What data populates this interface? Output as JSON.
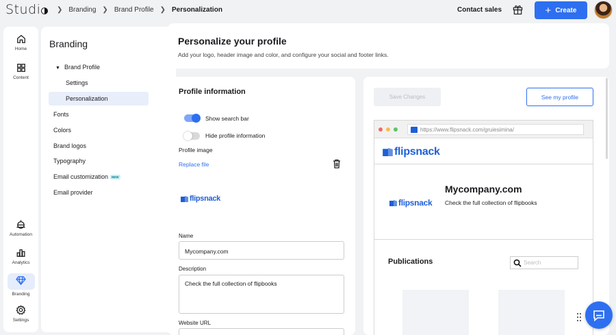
{
  "app": {
    "logo_text": "Studi"
  },
  "breadcrumb": [
    "Branding",
    "Brand Profile",
    "Personalization"
  ],
  "topbar": {
    "contact_sales": "Contact sales",
    "create_label": "Create"
  },
  "rail": [
    {
      "label": "Home",
      "icon": "home-icon"
    },
    {
      "label": "Content",
      "icon": "grid-icon"
    },
    {
      "label": "Automation",
      "icon": "robot-icon"
    },
    {
      "label": "Analytics",
      "icon": "bar-chart-icon"
    },
    {
      "label": "Branding",
      "icon": "diamond-icon",
      "active": true
    },
    {
      "label": "Settings",
      "icon": "gear-icon"
    }
  ],
  "menu": {
    "title": "Branding",
    "group": "Brand Profile",
    "sub_items": [
      "Settings",
      "Personalization"
    ],
    "items": [
      "Fonts",
      "Colors",
      "Brand logos",
      "Typography",
      "Email customization",
      "Email provider"
    ],
    "new_badge": "NEW"
  },
  "page": {
    "title": "Personalize your profile",
    "subtitle": "Add your logo, header image and color, and configure your social and footer links."
  },
  "form": {
    "section_title": "Profile information",
    "toggle_search": {
      "label": "Show search bar",
      "on": true
    },
    "toggle_hide": {
      "label": "Hide profile information",
      "on": false
    },
    "profile_image_label": "Profile image",
    "replace_file": "Replace file",
    "logo_text": "flipsnack",
    "name_label": "Name",
    "name_value": "Mycompany.com",
    "description_label": "Description",
    "description_value": "Check the full collection of flipbooks",
    "website_label": "Website URL"
  },
  "preview": {
    "save_changes": "Save Changes",
    "see_profile": "See my profile",
    "url": "https://www.flipsnack.com/gruiesimina/",
    "brand": "flipsnack",
    "company": "Mycompany.com",
    "company_desc": "Check the full collection of flipbooks",
    "publications": "Publications",
    "search_placeholder": "Search"
  },
  "colors": {
    "accent": "#2d6ff0",
    "brand_blue": "#1e5fd6",
    "badge_bg": "#c8f1f6"
  }
}
